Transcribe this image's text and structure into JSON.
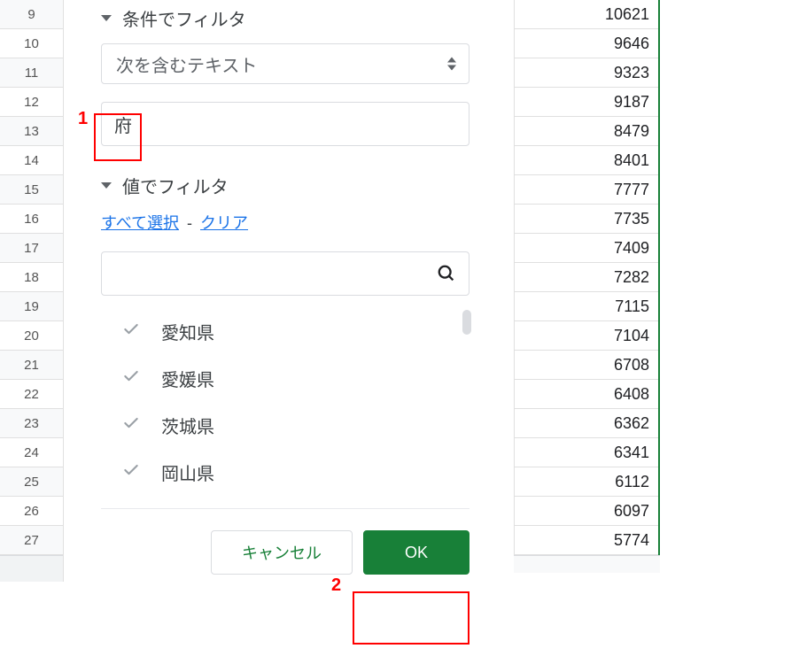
{
  "rowHeaders": [
    "9",
    "10",
    "11",
    "12",
    "13",
    "14",
    "15",
    "16",
    "17",
    "18",
    "19",
    "20",
    "21",
    "22",
    "23",
    "24",
    "25",
    "26",
    "27"
  ],
  "dataCells": [
    "10621",
    "9646",
    "9323",
    "9187",
    "8479",
    "8401",
    "7777",
    "7735",
    "7409",
    "7282",
    "7115",
    "7104",
    "6708",
    "6408",
    "6362",
    "6341",
    "6112",
    "6097",
    "5774"
  ],
  "filter": {
    "conditionHeader": "条件でフィルタ",
    "conditionDropdown": "次を含むテキスト",
    "conditionValue": "府",
    "valueHeader": "値でフィルタ",
    "selectAll": "すべて選択",
    "clear": "クリア",
    "searchValue": "",
    "items": [
      "愛知県",
      "愛媛県",
      "茨城県",
      "岡山県"
    ]
  },
  "buttons": {
    "cancel": "キャンセル",
    "ok": "OK"
  },
  "annotations": {
    "one": "1",
    "two": "2"
  }
}
